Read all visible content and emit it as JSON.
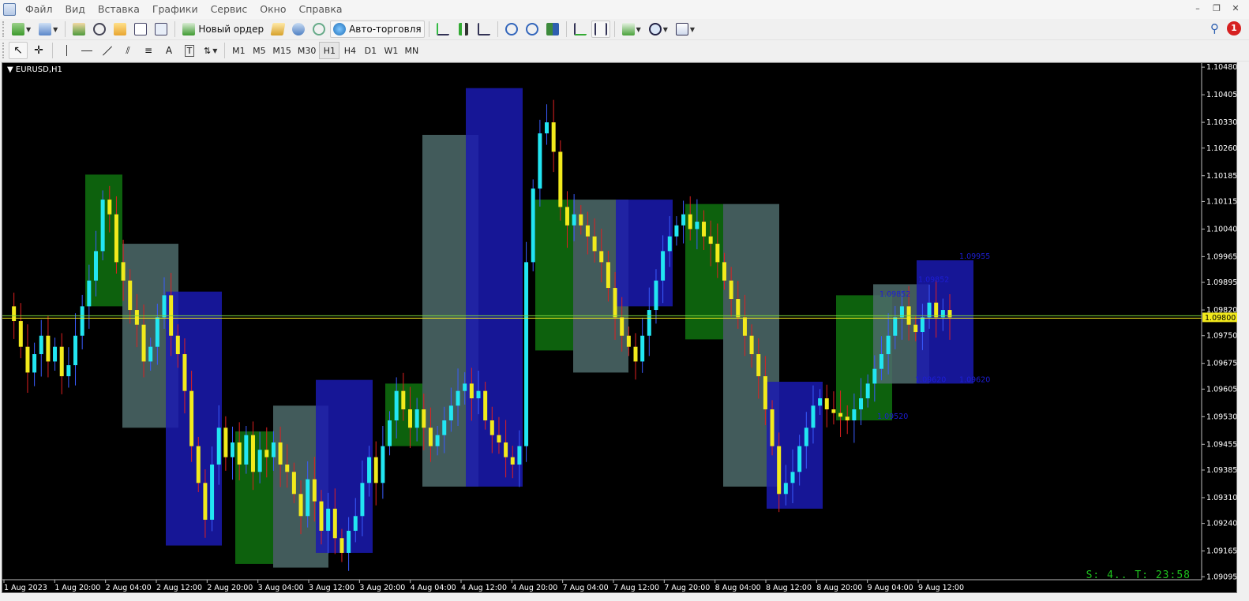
{
  "menu": {
    "items": [
      "Файл",
      "Вид",
      "Вставка",
      "Графики",
      "Сервис",
      "Окно",
      "Справка"
    ]
  },
  "toolbar": {
    "new_order_label": "Новый ордер",
    "auto_trading_label": "Авто-торговля",
    "notification_count": "1"
  },
  "timeframes": [
    "M1",
    "M5",
    "M15",
    "M30",
    "H1",
    "H4",
    "D1",
    "W1",
    "MN"
  ],
  "active_timeframe": "H1",
  "chart": {
    "symbol": "EURUSD,H1",
    "status": "S: 4.. T: 23:58",
    "current_price": "1.09800"
  },
  "chart_data": {
    "type": "candlestick",
    "symbol": "EURUSD",
    "timeframe": "H1",
    "y_axis_labels": [
      "1.10480",
      "1.10405",
      "1.10330",
      "1.10260",
      "1.10185",
      "1.10115",
      "1.10040",
      "1.09965",
      "1.09895",
      "1.09820",
      "1.09750",
      "1.09675",
      "1.09605",
      "1.09530",
      "1.09455",
      "1.09385",
      "1.09310",
      "1.09240",
      "1.09165",
      "1.09095"
    ],
    "x_axis_labels": [
      "1 Aug 2023",
      "1 Aug 20:00",
      "2 Aug 04:00",
      "2 Aug 12:00",
      "2 Aug 20:00",
      "3 Aug 04:00",
      "3 Aug 12:00",
      "3 Aug 20:00",
      "4 Aug 04:00",
      "4 Aug 12:00",
      "4 Aug 20:00",
      "7 Aug 04:00",
      "7 Aug 12:00",
      "7 Aug 20:00",
      "8 Aug 04:00",
      "8 Aug 12:00",
      "8 Aug 20:00",
      "9 Aug 04:00",
      "9 Aug 12:00"
    ],
    "ylim": [
      1.09087,
      1.10491
    ],
    "current_price": 1.098,
    "price_annotations": [
      "1.09955",
      "1.09852",
      "1.09852",
      "1.09620",
      "1.09620",
      "1.09520"
    ],
    "close_series": [
      1.0983,
      1.0979,
      1.0972,
      1.0965,
      1.097,
      1.0975,
      1.0968,
      1.0972,
      1.0964,
      1.0967,
      1.0975,
      1.0983,
      1.099,
      1.0998,
      1.1012,
      1.1008,
      1.0995,
      1.099,
      1.0982,
      1.0978,
      1.0968,
      1.0972,
      1.098,
      1.0986,
      1.0975,
      1.097,
      1.096,
      1.0945,
      1.0935,
      1.0925,
      1.094,
      1.095,
      1.0942,
      1.0946,
      1.094,
      1.0948,
      1.0938,
      1.0944,
      1.0942,
      1.0946,
      1.094,
      1.0938,
      1.0932,
      1.0926,
      1.0936,
      1.093,
      1.0922,
      1.0928,
      1.092,
      1.0916,
      1.0922,
      1.0926,
      1.0935,
      1.0942,
      1.0935,
      1.0945,
      1.0952,
      1.096,
      1.0955,
      1.095,
      1.0955,
      1.095,
      1.0945,
      1.0948,
      1.0952,
      1.0956,
      1.096,
      1.0962,
      1.0958,
      1.096,
      1.0952,
      1.0948,
      1.0946,
      1.0942,
      1.094,
      1.0945,
      1.0995,
      1.1015,
      1.103,
      1.1033,
      1.1025,
      1.101,
      1.1005,
      1.1008,
      1.1005,
      1.1002,
      1.0998,
      1.0995,
      1.0988,
      1.098,
      1.0975,
      1.0972,
      1.0968,
      1.0975,
      1.0982,
      1.099,
      1.0998,
      1.1002,
      1.1005,
      1.1008,
      1.1004,
      1.1006,
      1.1002,
      1.1,
      1.0995,
      1.099,
      1.0985,
      1.098,
      1.0975,
      1.097,
      1.0964,
      1.0955,
      1.0945,
      1.0932,
      1.0935,
      1.0938,
      1.0945,
      1.095,
      1.0956,
      1.0958,
      1.0955,
      1.0954,
      1.0953,
      1.0952,
      1.0955,
      1.0958,
      1.0962,
      1.0966,
      1.097,
      1.0975,
      1.098,
      1.0983,
      1.0978,
      1.0976,
      1.098,
      1.0984,
      1.098,
      1.0982,
      1.098
    ]
  }
}
